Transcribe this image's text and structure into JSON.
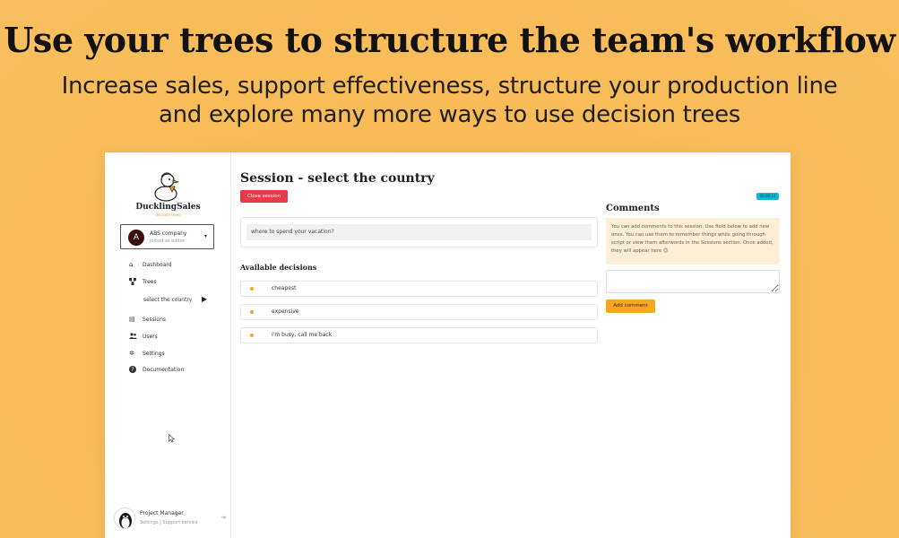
{
  "headline": "Use your trees to structure the team's workflow",
  "subline": {
    "line1": "Increase sales, support effectiveness, structure your production line",
    "line2": "and explore many more ways to use decision trees"
  },
  "app": {
    "brand": "DucklingSales",
    "brand_sub": "decision trees",
    "company": {
      "avatar_letter": "A",
      "name": "ABS company",
      "role": "Joined as editor"
    },
    "nav": [
      {
        "label": "Dashboard",
        "icon": "home-icon"
      },
      {
        "label": "Trees",
        "icon": "tree-icon"
      },
      {
        "label": "Sessions",
        "icon": "clipboard-icon"
      },
      {
        "label": "Users",
        "icon": "users-icon"
      },
      {
        "label": "Settings",
        "icon": "gear-icon"
      },
      {
        "label": "Documentation",
        "icon": "question-icon"
      }
    ],
    "active_tree": "select the country",
    "user": {
      "name": "Project Manager",
      "settings_link": "Settings",
      "support_link": "Support service"
    },
    "session": {
      "title": "Session - select the country",
      "close_label": "Close session",
      "timer": "00:00:10",
      "question": "where to spend your vacation?",
      "decisions_title": "Available decisions",
      "decisions": [
        "cheapest",
        "expensive",
        "I'm busy, call me back"
      ]
    },
    "comments": {
      "title": "Comments",
      "info": "You can add comments to this session. Use field below to add new ones. You can use them to remember things while going through script or view them afterwords in the Sessions section. Once added, they will appear here 😊",
      "add_label": "Add comment"
    }
  },
  "colors": {
    "background": "#f8bb57",
    "close_button": "#e53a4a",
    "timer_badge": "#1ab2d8",
    "accent": "#f5a623",
    "info_box": "#fcefd6"
  }
}
